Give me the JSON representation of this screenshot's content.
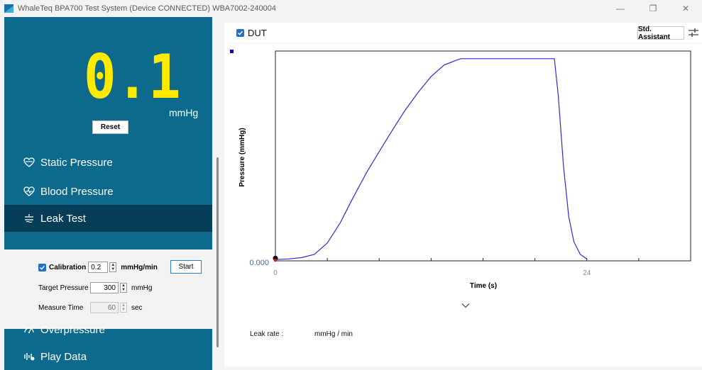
{
  "window": {
    "title": "WhaleTeq BPA700 Test System (Device CONNECTED)   WBA7002-240004",
    "minimize_glyph": "—",
    "restore_glyph": "❐",
    "close_glyph": "✕"
  },
  "readout": {
    "value": "0.1",
    "unit": "mmHg",
    "reset_label": "Reset"
  },
  "nav": {
    "items": [
      {
        "label": "Static Pressure",
        "icon": "heart-outline-icon",
        "active": false
      },
      {
        "label": "Blood Pressure",
        "icon": "heart-pulse-icon",
        "active": false
      },
      {
        "label": "Leak Test",
        "icon": "leak-icon",
        "active": true
      },
      {
        "label": "Overpressure",
        "icon": "gauge-icon",
        "active": false
      },
      {
        "label": "Play Data",
        "icon": "waveform-icon",
        "active": false
      }
    ]
  },
  "leak_panel": {
    "calibration_label": "Calibration",
    "calibration_checked": true,
    "calibration_value": "0.2",
    "calibration_unit": "mmHg/min",
    "start_label": "Start",
    "target_pressure_label": "Target Pressure",
    "target_pressure_value": "300",
    "target_pressure_unit": "mmHg",
    "measure_time_label": "Measure Time",
    "measure_time_value": "60",
    "measure_time_unit": "sec"
  },
  "main": {
    "dut_label": "DUT",
    "dut_checked": true,
    "std_assistant_label": "Std. Assistant",
    "leak_rate_label": "Leak rate :",
    "leak_rate_unit": "mmHg / min"
  },
  "colors": {
    "sidebar": "#0d6a8c",
    "sidebar_active": "#063d57",
    "readout": "#ffea00",
    "trace": "#2b2bd6",
    "accent": "#1f6fc6"
  },
  "chart_data": {
    "type": "line",
    "title": "",
    "xlabel": "Time (s)",
    "ylabel": "Pressure (mmHg)",
    "x_ticks": [
      "0",
      "24"
    ],
    "y_ticks": [
      "0.000"
    ],
    "xlim": [
      0,
      32
    ],
    "ylim": [
      0,
      330
    ],
    "series": [
      {
        "x": [
          0,
          1,
          2,
          3,
          4,
          5,
          6,
          7,
          8,
          9,
          10,
          11,
          12,
          13,
          14,
          14.3,
          15,
          16,
          17,
          18,
          19,
          20,
          21,
          21.5,
          21.8,
          22.2,
          22.6,
          23,
          23.5,
          24
        ],
        "y": [
          2,
          3,
          5,
          10,
          28,
          60,
          100,
          138,
          172,
          205,
          237,
          265,
          290,
          308,
          316,
          318,
          318,
          318,
          318,
          318,
          318,
          318,
          318,
          318,
          260,
          150,
          70,
          30,
          10,
          3
        ]
      }
    ]
  }
}
